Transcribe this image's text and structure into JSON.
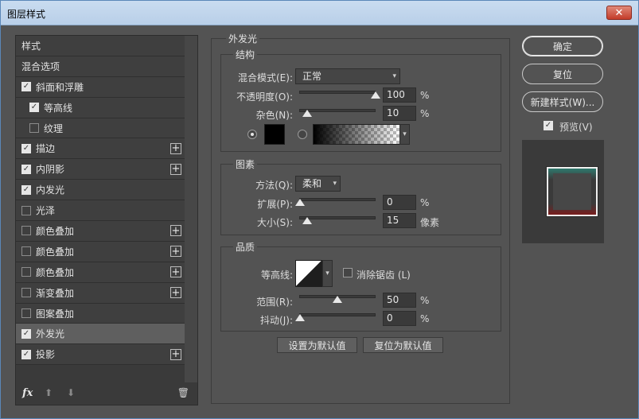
{
  "window": {
    "title": "图层样式",
    "close_glyph": "✕"
  },
  "left": {
    "items": [
      {
        "label": "样式",
        "checkbox": false,
        "checked": false,
        "plus": false,
        "indent": 0,
        "selected": false
      },
      {
        "label": "混合选项",
        "checkbox": false,
        "checked": false,
        "plus": false,
        "indent": 0,
        "selected": false
      },
      {
        "label": "斜面和浮雕",
        "checkbox": true,
        "checked": true,
        "plus": false,
        "indent": 0,
        "selected": false
      },
      {
        "label": "等高线",
        "checkbox": true,
        "checked": true,
        "plus": false,
        "indent": 1,
        "selected": false
      },
      {
        "label": "纹理",
        "checkbox": true,
        "checked": false,
        "plus": false,
        "indent": 1,
        "selected": false
      },
      {
        "label": "描边",
        "checkbox": true,
        "checked": true,
        "plus": true,
        "indent": 0,
        "selected": false
      },
      {
        "label": "内阴影",
        "checkbox": true,
        "checked": true,
        "plus": true,
        "indent": 0,
        "selected": false
      },
      {
        "label": "内发光",
        "checkbox": true,
        "checked": true,
        "plus": false,
        "indent": 0,
        "selected": false
      },
      {
        "label": "光泽",
        "checkbox": true,
        "checked": false,
        "plus": false,
        "indent": 0,
        "selected": false
      },
      {
        "label": "颜色叠加",
        "checkbox": true,
        "checked": false,
        "plus": true,
        "indent": 0,
        "selected": false
      },
      {
        "label": "颜色叠加",
        "checkbox": true,
        "checked": false,
        "plus": true,
        "indent": 0,
        "selected": false
      },
      {
        "label": "颜色叠加",
        "checkbox": true,
        "checked": false,
        "plus": true,
        "indent": 0,
        "selected": false
      },
      {
        "label": "渐变叠加",
        "checkbox": true,
        "checked": false,
        "plus": true,
        "indent": 0,
        "selected": false
      },
      {
        "label": "图案叠加",
        "checkbox": true,
        "checked": false,
        "plus": false,
        "indent": 0,
        "selected": false
      },
      {
        "label": "外发光",
        "checkbox": true,
        "checked": true,
        "plus": false,
        "indent": 0,
        "selected": true
      },
      {
        "label": "投影",
        "checkbox": true,
        "checked": true,
        "plus": true,
        "indent": 0,
        "selected": false
      }
    ],
    "footer": {
      "fx": "fx",
      "up_glyph": "⬆",
      "down_glyph": "⬇",
      "trash_glyph": "🗑"
    }
  },
  "panel": {
    "title": "外发光",
    "structure": {
      "title": "结构",
      "blend_label": "混合模式(E):",
      "blend_value": "正常",
      "opacity_label": "不透明度(O):",
      "opacity_value": "100",
      "noise_label": "杂色(N):",
      "noise_value": "10",
      "percent": "%",
      "opacity_fraction": 1.0,
      "noise_fraction": 0.1
    },
    "elements": {
      "title": "图素",
      "method_label": "方法(Q):",
      "method_value": "柔和",
      "spread_label": "扩展(P):",
      "spread_value": "0",
      "size_label": "大小(S):",
      "size_value": "15",
      "size_unit": "像素",
      "percent": "%"
    },
    "quality": {
      "title": "品质",
      "contour_label": "等高线:",
      "antialias_label": "消除锯齿 (L)",
      "antialias_checked": false,
      "range_label": "范围(R):",
      "range_value": "50",
      "jitter_label": "抖动(J):",
      "jitter_value": "0",
      "percent": "%"
    },
    "buttons": {
      "make_default": "设置为默认值",
      "reset_default": "复位为默认值"
    }
  },
  "right": {
    "ok": "确定",
    "reset": "复位",
    "new_style": "新建样式(W)...",
    "preview_label": "预览(V)",
    "preview_checked": true
  },
  "colors": {
    "glow_swatch": "#000000",
    "accent": "#5b87b8"
  },
  "icons": {
    "dropdown": "▾",
    "check": "✓",
    "plus": "+"
  }
}
